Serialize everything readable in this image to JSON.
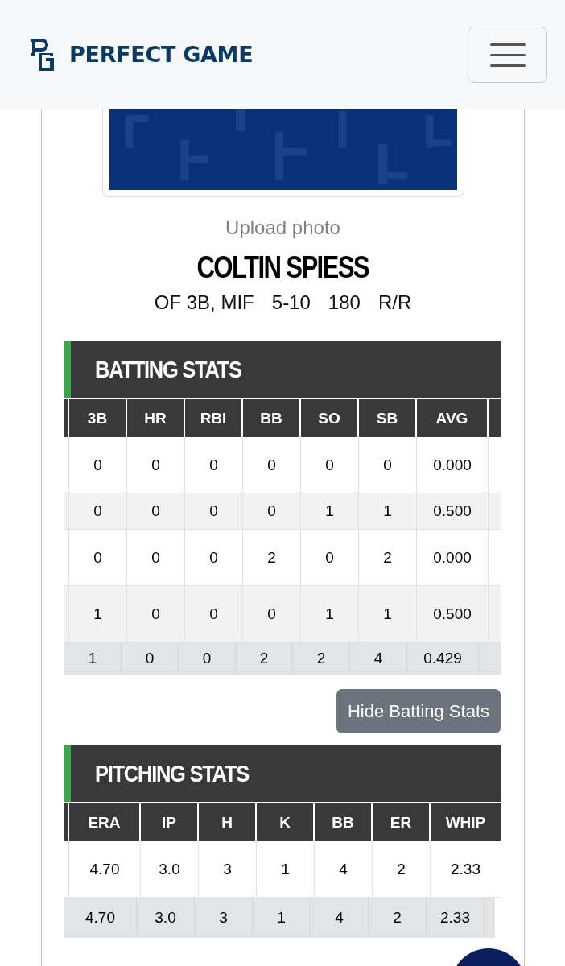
{
  "header": {
    "brand": "PERFECT GAME"
  },
  "profile": {
    "photo_link": "Upload photo",
    "name": "COLTIN SPIESS",
    "details": [
      "OF 3B, MIF",
      "5-10",
      "180",
      "R/R"
    ]
  },
  "sections": [
    {
      "kind": "batting",
      "title": "BATTING STATS",
      "columns": [
        "3B",
        "HR",
        "RBI",
        "BB",
        "SO",
        "SB",
        "AVG"
      ],
      "rows": [
        {
          "kind": "game",
          "cells": [
            "0",
            "0",
            "0",
            "0",
            "0",
            "0",
            "0.000"
          ]
        },
        {
          "kind": "game",
          "cells": [
            "0",
            "0",
            "0",
            "0",
            "1",
            "1",
            "0.500"
          ]
        },
        {
          "kind": "game",
          "cells": [
            "0",
            "0",
            "0",
            "2",
            "0",
            "2",
            "0.000"
          ]
        },
        {
          "kind": "game",
          "cells": [
            "1",
            "0",
            "0",
            "0",
            "1",
            "1",
            "0.500"
          ]
        },
        {
          "kind": "total",
          "cells": [
            "1",
            "0",
            "0",
            "2",
            "2",
            "4",
            "0.429"
          ]
        }
      ],
      "toggle_button": "Hide Batting Stats"
    },
    {
      "kind": "pitching",
      "title": "PITCHING STATS",
      "columns": [
        "ERA",
        "IP",
        "H",
        "K",
        "BB",
        "ER",
        "WHIP"
      ],
      "rows": [
        {
          "kind": "game",
          "cells": [
            "4.70",
            "3.0",
            "3",
            "1",
            "4",
            "2",
            "2.33"
          ]
        },
        {
          "kind": "total",
          "cells": [
            "4.70",
            "3.0",
            "3",
            "1",
            "4",
            "2",
            "2.33"
          ]
        }
      ]
    }
  ]
}
